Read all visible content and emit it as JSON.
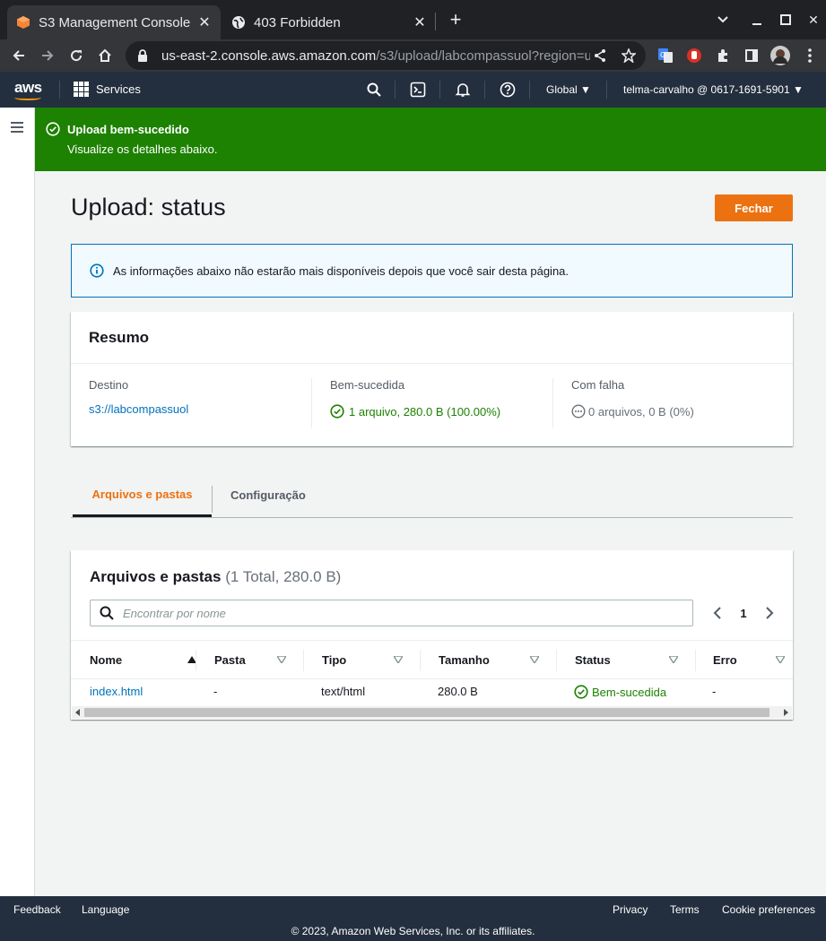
{
  "browser": {
    "tabs": [
      {
        "title": "S3 Management Console",
        "active": true
      },
      {
        "title": "403 Forbidden",
        "active": false
      }
    ],
    "url_host": "us-east-2.console.aws.amazon.com",
    "url_path": "/s3/upload/labcompassuol?region=us-e..."
  },
  "awsnav": {
    "logo": "aws",
    "services": "Services",
    "region": "Global",
    "account": "telma-carvalho @ 0617-1691-5901"
  },
  "flash": {
    "header": "Upload bem-sucedido",
    "description": "Visualize os detalhes abaixo."
  },
  "page": {
    "title": "Upload: status",
    "close_button": "Fechar",
    "info": "As informações abaixo não estarão mais disponíveis depois que você sair desta página."
  },
  "summary": {
    "title": "Resumo",
    "destination_label": "Destino",
    "destination_value": "s3://labcompassuol",
    "success_label": "Bem-sucedida",
    "success_value": "1 arquivo, 280.0 B (100.00%)",
    "failed_label": "Com falha",
    "failed_value": "0 arquivos, 0 B (0%)"
  },
  "tabs": [
    {
      "label": "Arquivos e pastas",
      "active": true
    },
    {
      "label": "Configuração",
      "active": false
    }
  ],
  "files": {
    "title": "Arquivos e pastas",
    "count": "(1 Total, 280.0 B)",
    "search_placeholder": "Encontrar por nome",
    "page": "1",
    "columns": [
      "Nome",
      "Pasta",
      "Tipo",
      "Tamanho",
      "Status",
      "Erro"
    ],
    "rows": [
      {
        "name": "index.html",
        "folder": "-",
        "type": "text/html",
        "size": "280.0 B",
        "status": "Bem-sucedida",
        "error": "-"
      }
    ]
  },
  "footer": {
    "feedback": "Feedback",
    "language": "Language",
    "privacy": "Privacy",
    "terms": "Terms",
    "cookies": "Cookie preferences",
    "copyright": "© 2023, Amazon Web Services, Inc. or its affiliates."
  },
  "colors": {
    "success": "#1d8102",
    "accent": "#ec7211",
    "link": "#0073bb",
    "nav": "#232f3e"
  }
}
